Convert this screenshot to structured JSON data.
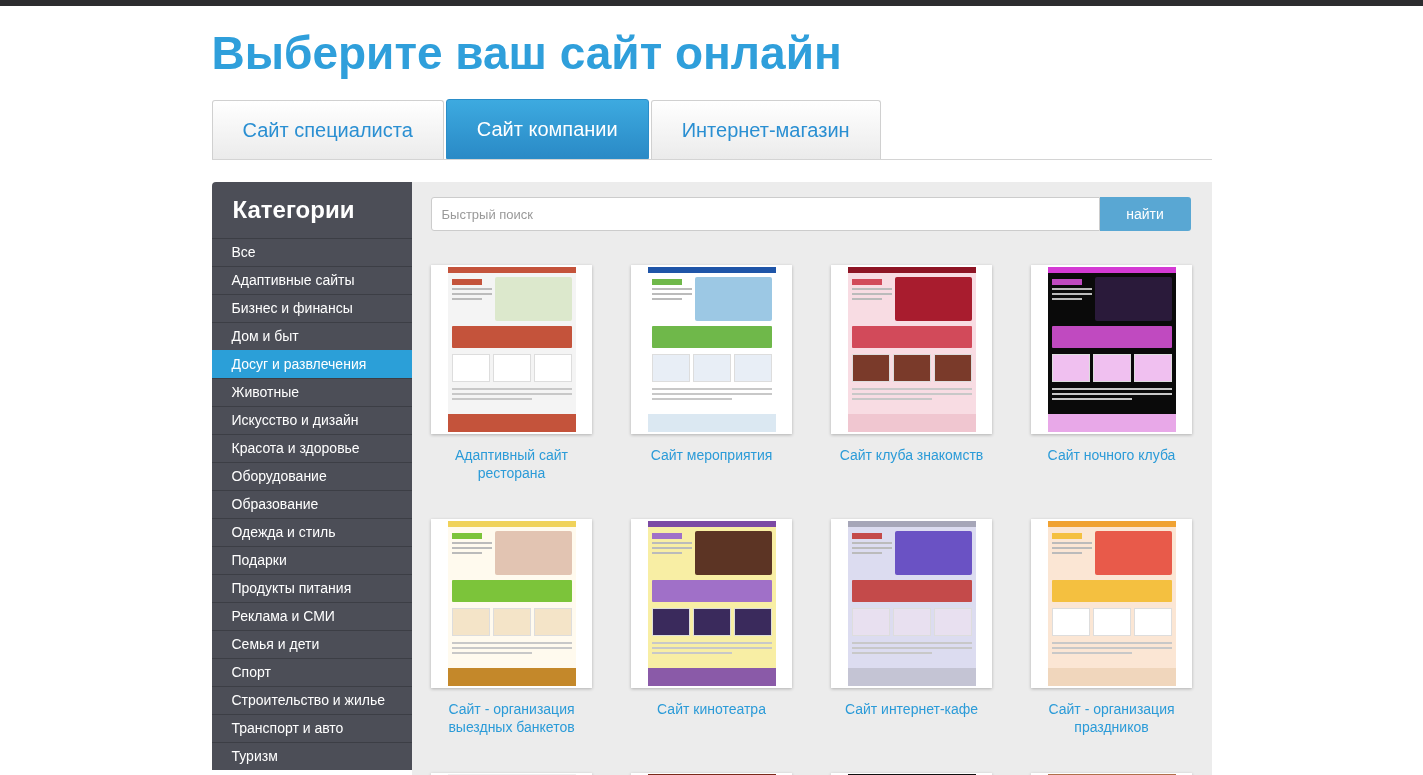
{
  "title": "Выберите ваш сайт онлайн",
  "tabs": [
    {
      "label": "Сайт специалиста",
      "selected": false
    },
    {
      "label": "Сайт компании",
      "selected": true
    },
    {
      "label": "Интернет-магазин",
      "selected": false
    }
  ],
  "sidebar": {
    "heading": "Категории",
    "items": [
      {
        "label": "Все",
        "selected": false
      },
      {
        "label": "Адаптивные сайты",
        "selected": false
      },
      {
        "label": "Бизнес и финансы",
        "selected": false
      },
      {
        "label": "Дом и быт",
        "selected": false
      },
      {
        "label": "Досуг и развлечения",
        "selected": true
      },
      {
        "label": "Животные",
        "selected": false
      },
      {
        "label": "Искусство и дизайн",
        "selected": false
      },
      {
        "label": "Красота и здоровье",
        "selected": false
      },
      {
        "label": "Оборудование",
        "selected": false
      },
      {
        "label": "Образование",
        "selected": false
      },
      {
        "label": "Одежда и стиль",
        "selected": false
      },
      {
        "label": "Подарки",
        "selected": false
      },
      {
        "label": "Продукты питания",
        "selected": false
      },
      {
        "label": "Реклама и СМИ",
        "selected": false
      },
      {
        "label": "Семья и дети",
        "selected": false
      },
      {
        "label": "Спорт",
        "selected": false
      },
      {
        "label": "Строительство и жилье",
        "selected": false
      },
      {
        "label": "Транспорт и авто",
        "selected": false
      },
      {
        "label": "Туризм",
        "selected": false
      }
    ]
  },
  "search": {
    "placeholder": "Быстрый поиск",
    "button": "найти"
  },
  "templates": [
    {
      "title": "Адаптивный сайт ресторана"
    },
    {
      "title": "Сайт мероприятия"
    },
    {
      "title": "Сайт клуба знакомств"
    },
    {
      "title": "Сайт ночного клуба"
    },
    {
      "title": "Сайт - организация выездных банкетов"
    },
    {
      "title": "Сайт кинотеатра"
    },
    {
      "title": "Сайт интернет-кафе"
    },
    {
      "title": "Сайт - организация праздников"
    }
  ]
}
